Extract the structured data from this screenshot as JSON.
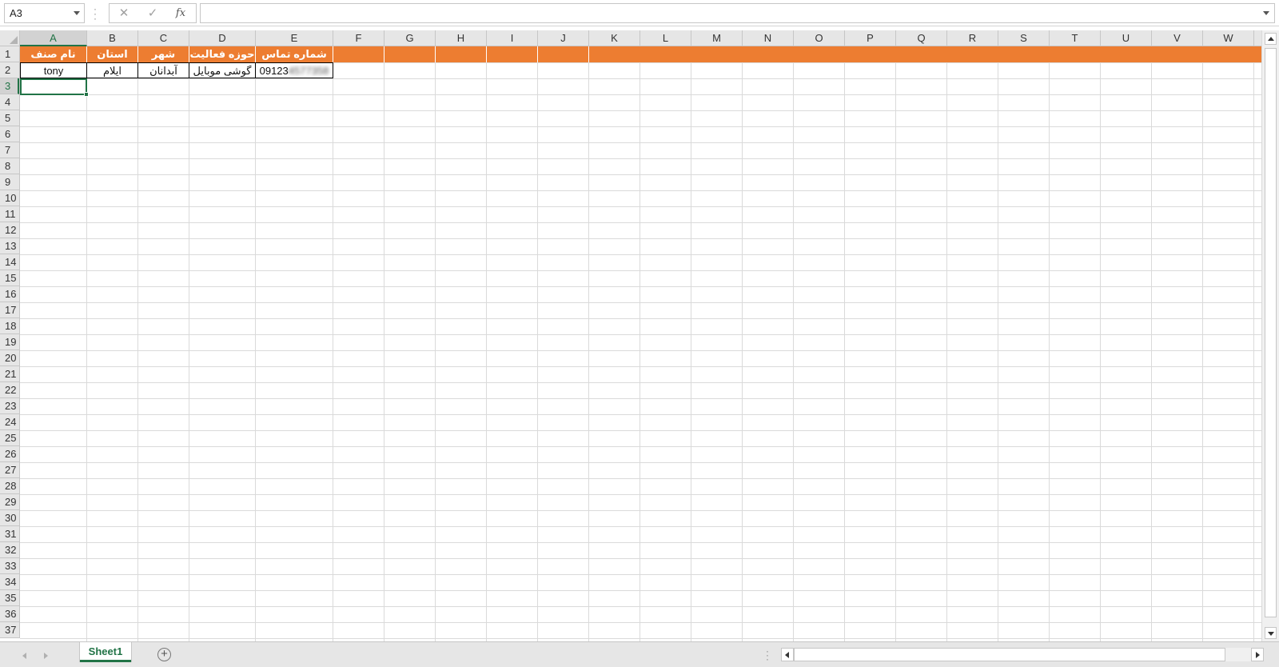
{
  "formula_bar": {
    "name_box": "A3",
    "cancel_glyph": "✕",
    "enter_glyph": "✓",
    "fx_label": "fx",
    "formula_value": ""
  },
  "columns": [
    "A",
    "B",
    "C",
    "D",
    "E",
    "F",
    "G",
    "H",
    "I",
    "J",
    "K",
    "L",
    "M",
    "N",
    "O",
    "P",
    "Q",
    "R",
    "S",
    "T",
    "U",
    "V",
    "W"
  ],
  "selected_column": "A",
  "rows": [
    "1",
    "2",
    "3",
    "4",
    "5",
    "6",
    "7",
    "8",
    "9",
    "10",
    "11",
    "12",
    "13",
    "14",
    "15",
    "16",
    "17",
    "18",
    "19",
    "20",
    "21",
    "22",
    "23",
    "24",
    "25",
    "26",
    "27",
    "28",
    "29",
    "30",
    "31",
    "32",
    "33",
    "34",
    "35",
    "36",
    "37"
  ],
  "selected_row": "3",
  "table": {
    "headers": [
      "نام صنف",
      "استان",
      "شهر",
      "حوزه فعالیت",
      "شماره تماس"
    ],
    "row2": [
      "tony",
      "ایلام",
      "آبدانان",
      "گوشی موبایل",
      "09123"
    ],
    "row2_phone_blurred": "4577358"
  },
  "sheets": {
    "tabs": [
      "Sheet1"
    ],
    "add_glyph": "+"
  },
  "colors": {
    "header_fill": "#ed7d31",
    "accent_green": "#217346"
  }
}
